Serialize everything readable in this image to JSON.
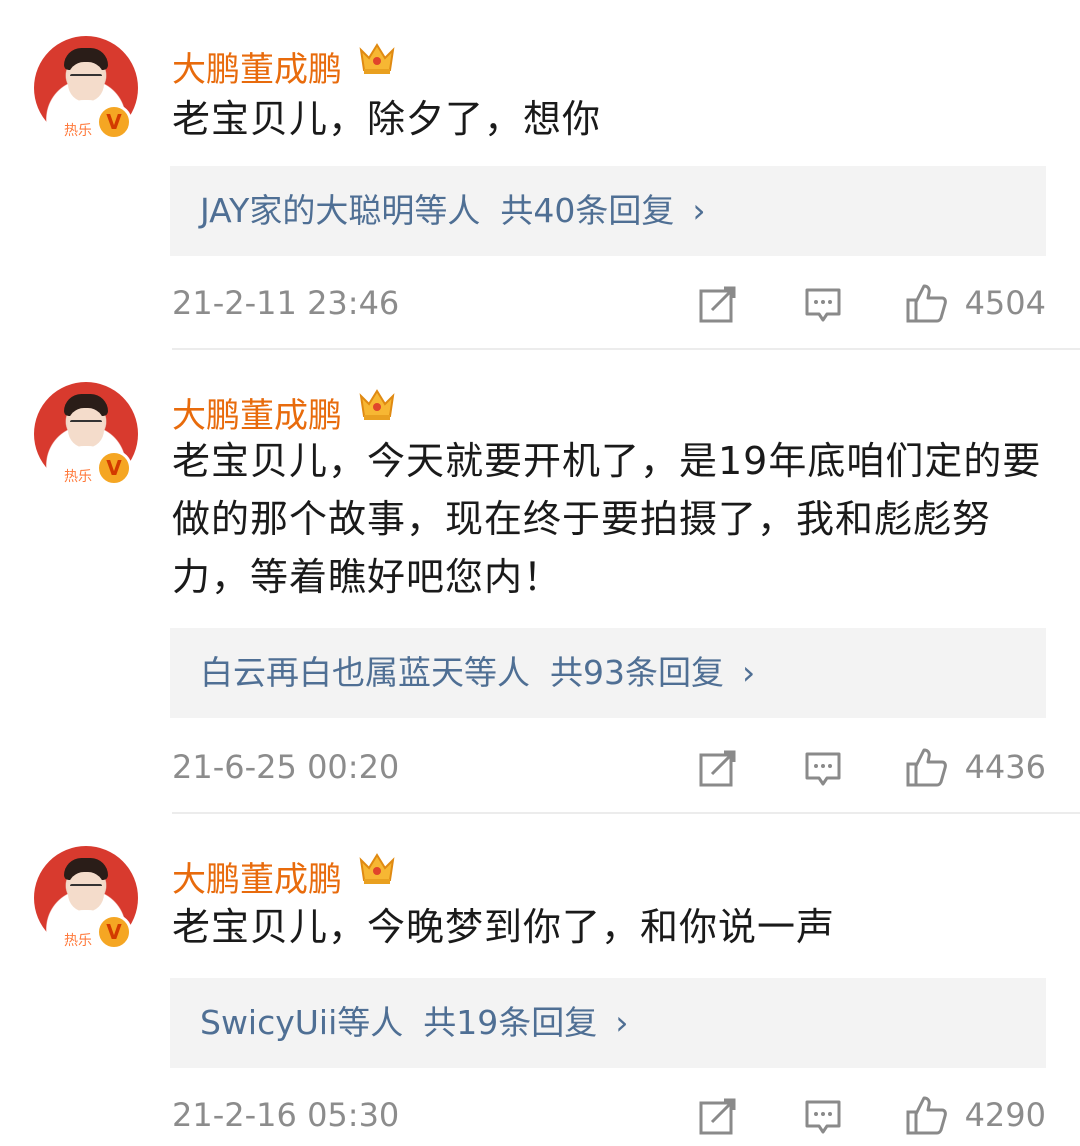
{
  "comments": [
    {
      "username": "大鹏董成鹏",
      "text": "老宝贝儿，除夕了，想你",
      "replies_who": "JAY家的大聪明等人",
      "replies_count": "共40条回复",
      "time": "21-2-11 23:46",
      "likes": "4504"
    },
    {
      "username": "大鹏董成鹏",
      "text": "老宝贝儿，今天就要开机了，是19年底咱们定的要做的那个故事，现在终于要拍摄了，我和彪彪努力，等着瞧好吧您内！",
      "replies_who": "白云再白也属蓝天等人",
      "replies_count": "共93条回复",
      "time": "21-6-25 00:20",
      "likes": "4436"
    },
    {
      "username": "大鹏董成鹏",
      "text": "老宝贝儿，今晚梦到你了，和你说一声",
      "replies_who": "SwicyUii等人",
      "replies_count": "共19条回复",
      "time": "21-2-16 05:30",
      "likes": "4290"
    }
  ],
  "chevron": "›",
  "verified_badge": "V",
  "avatar_tag": "热乐",
  "icons": [
    "crown-icon",
    "share-icon",
    "comment-icon",
    "like-icon"
  ],
  "colors": {
    "username": "#e86b0c",
    "link": "#4f6f94",
    "meta": "#8c8c8c",
    "reply_bg": "#f3f3f3"
  }
}
